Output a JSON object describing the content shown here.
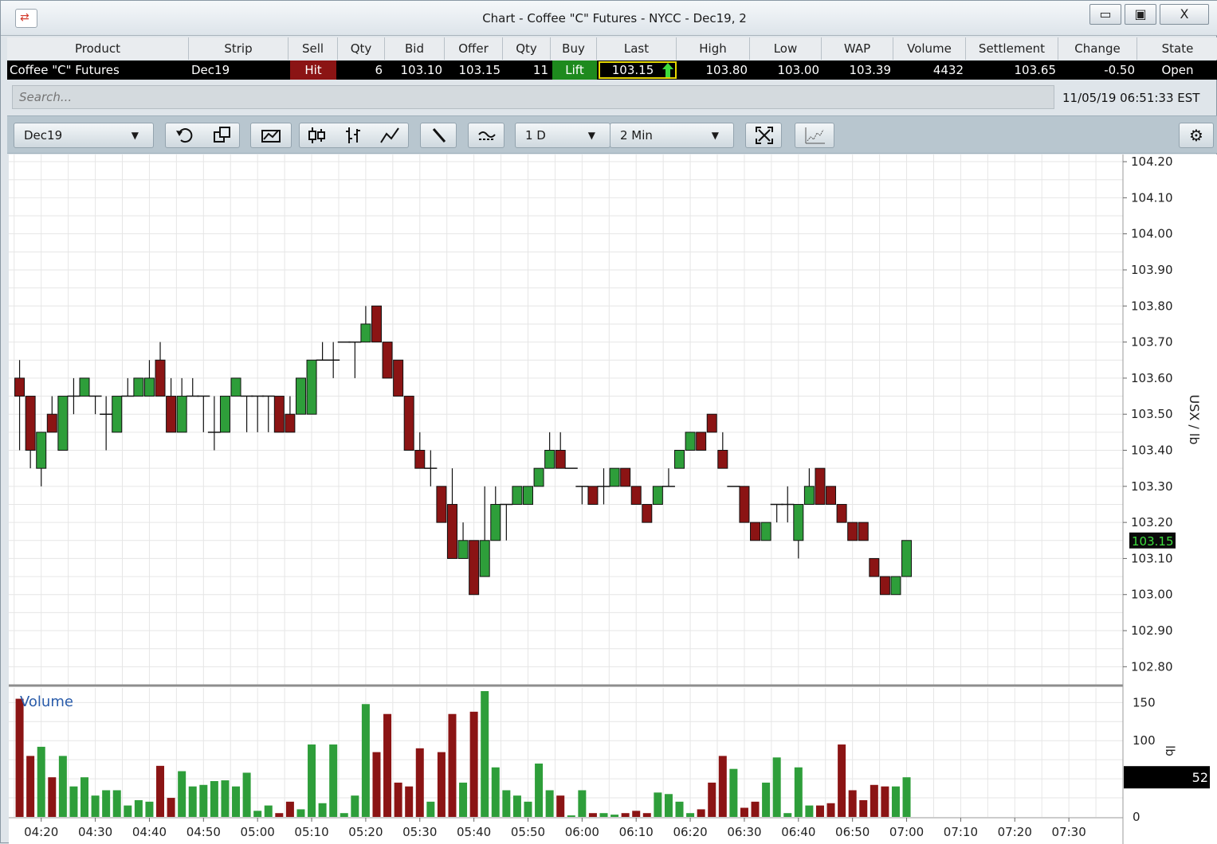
{
  "window": {
    "title": "Chart - Coffee \"C\" Futures - NYCC - Dec19, 2",
    "minimize_glyph": "▭",
    "maximize_glyph": "▣",
    "close_glyph": "X"
  },
  "quote": {
    "headers": [
      "Product",
      "Strip",
      "Sell",
      "Qty",
      "Bid",
      "Offer",
      "Qty",
      "Buy",
      "Last",
      "High",
      "Low",
      "WAP",
      "Volume",
      "Settlement",
      "Change",
      "State"
    ],
    "product": "Coffee \"C\" Futures",
    "strip": "Dec19",
    "sell": "Hit",
    "bid_qty": "6",
    "bid": "103.10",
    "offer": "103.15",
    "offer_qty": "11",
    "buy": "Lift",
    "last": "103.15",
    "high": "103.80",
    "low": "103.00",
    "wap": "103.39",
    "volume": "4432",
    "settlement": "103.65",
    "change": "-0.50",
    "state": "Open"
  },
  "search": {
    "placeholder": "Search..."
  },
  "timestamp": "11/05/19 06:51:33 EST",
  "toolbar": {
    "strip_select": "Dec19",
    "range_select": "1 D",
    "interval_select": "2 Min",
    "icons": [
      "refresh-icon",
      "copy-icon",
      "envelope-chart-icon",
      "candlestick-icon",
      "ohlc-bar-icon",
      "line-chart-icon",
      "drawing-line-icon",
      "study-icon",
      "fullscreen-icon",
      "chart-style-icon",
      "settings-icon"
    ]
  },
  "colors": {
    "up": "#2e9e3a",
    "down": "#8b1414",
    "grid": "#e6e6e6",
    "last_bg": "#0a0a0a",
    "last_fg": "#3ddc3d"
  },
  "chart_data": {
    "type": "candlestick",
    "interval": "2 Min",
    "price_axis": {
      "label": "USX / lb",
      "ticks": [
        "104.20",
        "104.10",
        "104.00",
        "103.90",
        "103.80",
        "103.70",
        "103.60",
        "103.50",
        "103.40",
        "103.30",
        "103.20",
        "103.10",
        "103.00",
        "102.90",
        "102.80"
      ],
      "ylim": [
        102.75,
        104.22
      ],
      "last_marker": "103.15"
    },
    "time_axis": {
      "ticks": [
        "04:20",
        "04:30",
        "04:40",
        "04:50",
        "05:00",
        "05:10",
        "05:20",
        "05:30",
        "05:40",
        "05:50",
        "06:00",
        "06:10",
        "06:20",
        "06:30",
        "06:40",
        "06:50",
        "07:00",
        "07:10",
        "07:20",
        "07:30"
      ],
      "range": [
        "04:14",
        "07:40"
      ]
    },
    "volume_axis": {
      "label": "lb",
      "title": "Volume",
      "ticks": [
        "150",
        "100",
        "0"
      ],
      "ylim": [
        0,
        165
      ],
      "last_marker": "52"
    },
    "bars": [
      {
        "t": "04:16",
        "o": 103.6,
        "h": 103.65,
        "l": 103.4,
        "c": 103.55,
        "v": 155
      },
      {
        "t": "04:18",
        "o": 103.55,
        "h": 103.55,
        "l": 103.35,
        "c": 103.4,
        "v": 80
      },
      {
        "t": "04:20",
        "o": 103.35,
        "h": 103.45,
        "l": 103.3,
        "c": 103.45,
        "v": 92
      },
      {
        "t": "04:22",
        "o": 103.5,
        "h": 103.55,
        "l": 103.45,
        "c": 103.45,
        "v": 52
      },
      {
        "t": "04:24",
        "o": 103.4,
        "h": 103.55,
        "l": 103.4,
        "c": 103.55,
        "v": 80
      },
      {
        "t": "04:26",
        "o": 103.55,
        "h": 103.6,
        "l": 103.5,
        "c": 103.55,
        "v": 40
      },
      {
        "t": "04:28",
        "o": 103.55,
        "h": 103.6,
        "l": 103.55,
        "c": 103.6,
        "v": 52
      },
      {
        "t": "04:30",
        "o": 103.55,
        "h": 103.55,
        "l": 103.5,
        "c": 103.55,
        "v": 28
      },
      {
        "t": "04:32",
        "o": 103.5,
        "h": 103.55,
        "l": 103.4,
        "c": 103.5,
        "v": 35
      },
      {
        "t": "04:34",
        "o": 103.45,
        "h": 103.55,
        "l": 103.45,
        "c": 103.55,
        "v": 35
      },
      {
        "t": "04:36",
        "o": 103.55,
        "h": 103.6,
        "l": 103.55,
        "c": 103.55,
        "v": 15
      },
      {
        "t": "04:38",
        "o": 103.55,
        "h": 103.6,
        "l": 103.55,
        "c": 103.6,
        "v": 22
      },
      {
        "t": "04:40",
        "o": 103.55,
        "h": 103.65,
        "l": 103.55,
        "c": 103.6,
        "v": 20
      },
      {
        "t": "04:42",
        "o": 103.65,
        "h": 103.7,
        "l": 103.55,
        "c": 103.55,
        "v": 67
      },
      {
        "t": "04:44",
        "o": 103.55,
        "h": 103.6,
        "l": 103.45,
        "c": 103.45,
        "v": 25
      },
      {
        "t": "04:46",
        "o": 103.45,
        "h": 103.6,
        "l": 103.45,
        "c": 103.55,
        "v": 60
      },
      {
        "t": "04:48",
        "o": 103.55,
        "h": 103.6,
        "l": 103.55,
        "c": 103.55,
        "v": 40
      },
      {
        "t": "04:50",
        "o": 103.55,
        "h": 103.55,
        "l": 103.45,
        "c": 103.55,
        "v": 42
      },
      {
        "t": "04:52",
        "o": 103.45,
        "h": 103.55,
        "l": 103.4,
        "c": 103.45,
        "v": 47
      },
      {
        "t": "04:54",
        "o": 103.45,
        "h": 103.55,
        "l": 103.45,
        "c": 103.55,
        "v": 48
      },
      {
        "t": "04:56",
        "o": 103.55,
        "h": 103.6,
        "l": 103.55,
        "c": 103.6,
        "v": 40
      },
      {
        "t": "04:58",
        "o": 103.55,
        "h": 103.55,
        "l": 103.45,
        "c": 103.55,
        "v": 58
      },
      {
        "t": "05:00",
        "o": 103.55,
        "h": 103.55,
        "l": 103.45,
        "c": 103.55,
        "v": 8
      },
      {
        "t": "05:02",
        "o": 103.55,
        "h": 103.55,
        "l": 103.45,
        "c": 103.55,
        "v": 15
      },
      {
        "t": "05:04",
        "o": 103.55,
        "h": 103.55,
        "l": 103.45,
        "c": 103.45,
        "v": 5
      },
      {
        "t": "05:06",
        "o": 103.5,
        "h": 103.55,
        "l": 103.45,
        "c": 103.45,
        "v": 20
      },
      {
        "t": "05:08",
        "o": 103.5,
        "h": 103.6,
        "l": 103.5,
        "c": 103.6,
        "v": 10
      },
      {
        "t": "05:10",
        "o": 103.5,
        "h": 103.65,
        "l": 103.5,
        "c": 103.65,
        "v": 95
      },
      {
        "t": "05:12",
        "o": 103.65,
        "h": 103.7,
        "l": 103.65,
        "c": 103.65,
        "v": 18
      },
      {
        "t": "05:14",
        "o": 103.65,
        "h": 103.7,
        "l": 103.6,
        "c": 103.65,
        "v": 95
      },
      {
        "t": "05:16",
        "o": 103.7,
        "h": 103.7,
        "l": 103.7,
        "c": 103.7,
        "v": 5
      },
      {
        "t": "05:18",
        "o": 103.7,
        "h": 103.7,
        "l": 103.6,
        "c": 103.7,
        "v": 28
      },
      {
        "t": "05:20",
        "o": 103.7,
        "h": 103.8,
        "l": 103.7,
        "c": 103.75,
        "v": 148
      },
      {
        "t": "05:22",
        "o": 103.8,
        "h": 103.8,
        "l": 103.7,
        "c": 103.7,
        "v": 85
      },
      {
        "t": "05:24",
        "o": 103.7,
        "h": 103.7,
        "l": 103.6,
        "c": 103.6,
        "v": 135
      },
      {
        "t": "05:26",
        "o": 103.65,
        "h": 103.65,
        "l": 103.55,
        "c": 103.55,
        "v": 45
      },
      {
        "t": "05:28",
        "o": 103.55,
        "h": 103.55,
        "l": 103.4,
        "c": 103.4,
        "v": 40
      },
      {
        "t": "05:30",
        "o": 103.4,
        "h": 103.45,
        "l": 103.35,
        "c": 103.35,
        "v": 90
      },
      {
        "t": "05:32",
        "o": 103.35,
        "h": 103.4,
        "l": 103.3,
        "c": 103.35,
        "v": 20
      },
      {
        "t": "05:34",
        "o": 103.3,
        "h": 103.3,
        "l": 103.2,
        "c": 103.2,
        "v": 85
      },
      {
        "t": "05:36",
        "o": 103.25,
        "h": 103.35,
        "l": 103.1,
        "c": 103.1,
        "v": 135
      },
      {
        "t": "05:38",
        "o": 103.1,
        "h": 103.2,
        "l": 103.1,
        "c": 103.15,
        "v": 45
      },
      {
        "t": "05:40",
        "o": 103.15,
        "h": 103.15,
        "l": 103.0,
        "c": 103.0,
        "v": 138
      },
      {
        "t": "05:42",
        "o": 103.05,
        "h": 103.3,
        "l": 103.05,
        "c": 103.15,
        "v": 165
      },
      {
        "t": "05:44",
        "o": 103.15,
        "h": 103.3,
        "l": 103.15,
        "c": 103.25,
        "v": 65
      },
      {
        "t": "05:46",
        "o": 103.25,
        "h": 103.25,
        "l": 103.15,
        "c": 103.25,
        "v": 35
      },
      {
        "t": "05:48",
        "o": 103.25,
        "h": 103.3,
        "l": 103.25,
        "c": 103.3,
        "v": 28
      },
      {
        "t": "05:50",
        "o": 103.25,
        "h": 103.3,
        "l": 103.25,
        "c": 103.3,
        "v": 20
      },
      {
        "t": "05:52",
        "o": 103.3,
        "h": 103.35,
        "l": 103.3,
        "c": 103.35,
        "v": 70
      },
      {
        "t": "05:54",
        "o": 103.35,
        "h": 103.45,
        "l": 103.35,
        "c": 103.4,
        "v": 35
      },
      {
        "t": "05:56",
        "o": 103.4,
        "h": 103.45,
        "l": 103.35,
        "c": 103.35,
        "v": 28
      },
      {
        "t": "05:58",
        "o": 103.35,
        "h": 103.35,
        "l": 103.35,
        "c": 103.35,
        "v": 2
      },
      {
        "t": "06:00",
        "o": 103.3,
        "h": 103.3,
        "l": 103.25,
        "c": 103.3,
        "v": 35
      },
      {
        "t": "06:02",
        "o": 103.3,
        "h": 103.3,
        "l": 103.25,
        "c": 103.25,
        "v": 5
      },
      {
        "t": "06:04",
        "o": 103.3,
        "h": 103.35,
        "l": 103.25,
        "c": 103.3,
        "v": 5
      },
      {
        "t": "06:06",
        "o": 103.3,
        "h": 103.35,
        "l": 103.3,
        "c": 103.35,
        "v": 3
      },
      {
        "t": "06:08",
        "o": 103.35,
        "h": 103.35,
        "l": 103.3,
        "c": 103.3,
        "v": 5
      },
      {
        "t": "06:10",
        "o": 103.3,
        "h": 103.3,
        "l": 103.25,
        "c": 103.25,
        "v": 8
      },
      {
        "t": "06:12",
        "o": 103.25,
        "h": 103.25,
        "l": 103.2,
        "c": 103.2,
        "v": 5
      },
      {
        "t": "06:14",
        "o": 103.25,
        "h": 103.3,
        "l": 103.25,
        "c": 103.3,
        "v": 32
      },
      {
        "t": "06:16",
        "o": 103.3,
        "h": 103.35,
        "l": 103.3,
        "c": 103.3,
        "v": 30
      },
      {
        "t": "06:18",
        "o": 103.35,
        "h": 103.4,
        "l": 103.35,
        "c": 103.4,
        "v": 20
      },
      {
        "t": "06:20",
        "o": 103.4,
        "h": 103.45,
        "l": 103.4,
        "c": 103.45,
        "v": 5
      },
      {
        "t": "06:22",
        "o": 103.45,
        "h": 103.45,
        "l": 103.4,
        "c": 103.4,
        "v": 10
      },
      {
        "t": "06:24",
        "o": 103.5,
        "h": 103.5,
        "l": 103.45,
        "c": 103.45,
        "v": 45
      },
      {
        "t": "06:26",
        "o": 103.4,
        "h": 103.45,
        "l": 103.35,
        "c": 103.35,
        "v": 80
      },
      {
        "t": "06:28",
        "o": 103.3,
        "h": 103.3,
        "l": 103.3,
        "c": 103.3,
        "v": 63
      },
      {
        "t": "06:30",
        "o": 103.3,
        "h": 103.3,
        "l": 103.2,
        "c": 103.2,
        "v": 12
      },
      {
        "t": "06:32",
        "o": 103.2,
        "h": 103.2,
        "l": 103.15,
        "c": 103.15,
        "v": 20
      },
      {
        "t": "06:34",
        "o": 103.15,
        "h": 103.2,
        "l": 103.15,
        "c": 103.2,
        "v": 45
      },
      {
        "t": "06:36",
        "o": 103.25,
        "h": 103.25,
        "l": 103.2,
        "c": 103.25,
        "v": 78
      },
      {
        "t": "06:38",
        "o": 103.25,
        "h": 103.3,
        "l": 103.2,
        "c": 103.25,
        "v": 5
      },
      {
        "t": "06:40",
        "o": 103.15,
        "h": 103.25,
        "l": 103.1,
        "c": 103.25,
        "v": 65
      },
      {
        "t": "06:42",
        "o": 103.25,
        "h": 103.35,
        "l": 103.25,
        "c": 103.3,
        "v": 15
      },
      {
        "t": "06:44",
        "o": 103.35,
        "h": 103.35,
        "l": 103.25,
        "c": 103.25,
        "v": 15
      },
      {
        "t": "06:46",
        "o": 103.3,
        "h": 103.3,
        "l": 103.25,
        "c": 103.25,
        "v": 18
      },
      {
        "t": "06:48",
        "o": 103.25,
        "h": 103.25,
        "l": 103.2,
        "c": 103.2,
        "v": 95
      },
      {
        "t": "06:50",
        "o": 103.2,
        "h": 103.2,
        "l": 103.15,
        "c": 103.15,
        "v": 35
      },
      {
        "t": "06:52",
        "o": 103.2,
        "h": 103.2,
        "l": 103.15,
        "c": 103.15,
        "v": 22
      },
      {
        "t": "06:54",
        "o": 103.1,
        "h": 103.1,
        "l": 103.05,
        "c": 103.05,
        "v": 42
      },
      {
        "t": "06:56",
        "o": 103.05,
        "h": 103.05,
        "l": 103.0,
        "c": 103.0,
        "v": 40
      },
      {
        "t": "06:58",
        "o": 103.0,
        "h": 103.05,
        "l": 103.0,
        "c": 103.05,
        "v": 40
      },
      {
        "t": "07:00",
        "o": 103.05,
        "h": 103.15,
        "l": 103.05,
        "c": 103.15,
        "v": 52
      }
    ]
  }
}
